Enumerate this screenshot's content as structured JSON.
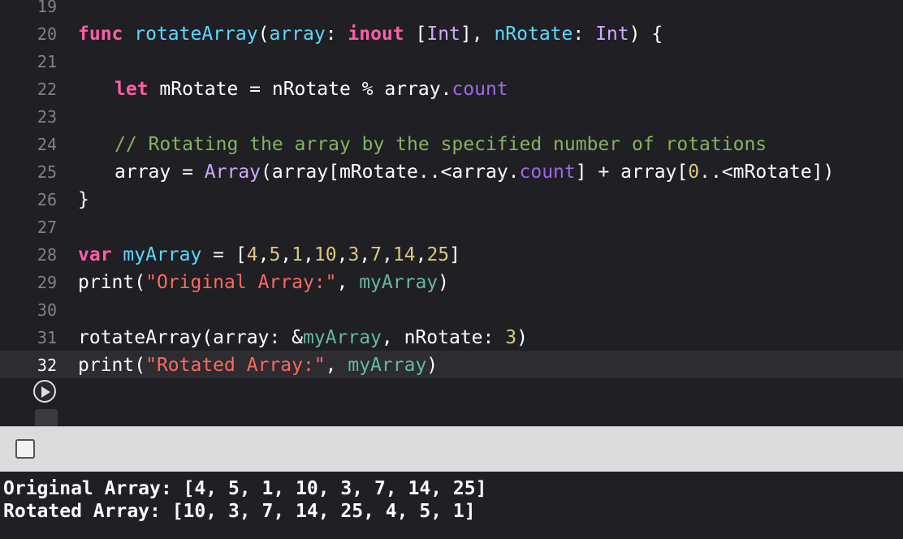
{
  "editor": {
    "line_numbers": [
      "19",
      "20",
      "21",
      "22",
      "23",
      "24",
      "25",
      "26",
      "27",
      "28",
      "29",
      "30",
      "31",
      "32"
    ],
    "active_line": "32",
    "code": {
      "l20": {
        "kw": "func",
        "fn": "rotateArray",
        "p1": "(",
        "arg1": "array",
        "c1": ": ",
        "kw2": "inout",
        "t1a": " [",
        "t1": "Int",
        "t1b": "], ",
        "arg2": "nRotate",
        "c2": ": ",
        "t2": "Int",
        "end": ") {"
      },
      "l22": {
        "kw": "let",
        "rest1": " mRotate = nRotate % array.",
        "prop": "count"
      },
      "l24": {
        "comment": "// Rotating the array by the specified number of rotations"
      },
      "l25": {
        "a": "array = ",
        "ty": "Array",
        "b": "(array[mRotate..<array.",
        "prop": "count",
        "c": "] + array[",
        "zero": "0",
        "d": "..<mRotate])"
      },
      "l26": {
        "text": "}"
      },
      "l28": {
        "kw": "var",
        "v": " myArray",
        "eq": " = [",
        "n1": "4",
        "s1": ",",
        "n2": "5",
        "s2": ",",
        "n3": "1",
        "s3": ",",
        "n4": "10",
        "s4": ",",
        "n5": "3",
        "s5": ",",
        "n6": "7",
        "s6": ",",
        "n7": "14",
        "s7": ",",
        "n8": "25",
        "end": "]"
      },
      "l29": {
        "fn": "print(",
        "str": "\"Original Array:\"",
        "sep": ", ",
        "v": "myArray",
        "end": ")"
      },
      "l31": {
        "fn": "rotateArray(array: &",
        "v": "myArray",
        "mid": ", nRotate: ",
        "num": "3",
        "end": ")"
      },
      "l32": {
        "fn": "print(",
        "str": "\"Rotated Array:\"",
        "sep": ", ",
        "v": "myArray",
        "end": ")"
      }
    }
  },
  "console": {
    "lines": [
      "Original Array: [4, 5, 1, 10, 3, 7, 14, 25]",
      "Rotated Array: [10, 3, 7, 14, 25, 4, 5, 1]"
    ]
  },
  "icons": {
    "run": "play-circle-icon",
    "toggle": "square-toggle-icon"
  }
}
